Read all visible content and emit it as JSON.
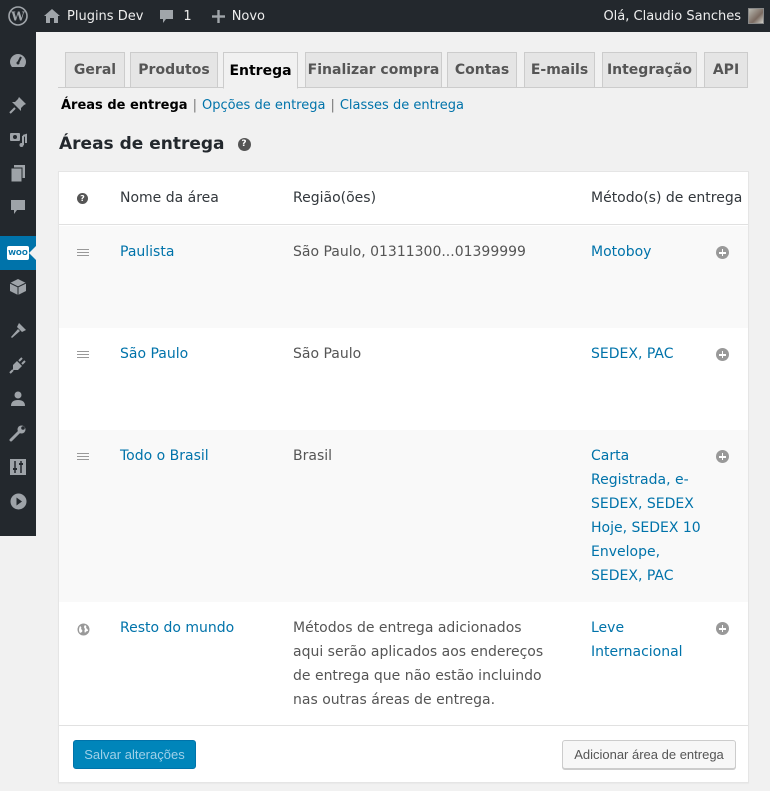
{
  "adminbar": {
    "site_name": "Plugins Dev",
    "comments_count": "1",
    "new_label": "Novo",
    "greeting": "Olá, Claudio Sanches"
  },
  "sidebar": {
    "items": [
      {
        "icon": "dashboard-icon"
      },
      {
        "icon": "pin-icon"
      },
      {
        "icon": "media-icon"
      },
      {
        "icon": "pages-icon"
      },
      {
        "icon": "comments-icon"
      },
      {
        "icon": "woocommerce-icon",
        "label": "WOO",
        "active": true
      },
      {
        "icon": "products-box-icon"
      },
      {
        "icon": "appearance-brush-icon"
      },
      {
        "icon": "plugins-icon"
      },
      {
        "icon": "users-icon"
      },
      {
        "icon": "tools-icon"
      },
      {
        "icon": "settings-icon"
      },
      {
        "icon": "play-icon"
      }
    ],
    "active_color": "#0073aa"
  },
  "tabs": [
    {
      "label": "Geral"
    },
    {
      "label": "Produtos"
    },
    {
      "label": "Entrega",
      "active": true
    },
    {
      "label": "Finalizar compra"
    },
    {
      "label": "Contas"
    },
    {
      "label": "E-mails"
    },
    {
      "label": "Integração"
    },
    {
      "label": "API"
    }
  ],
  "subnav": {
    "current": "Áreas de entrega",
    "links": [
      "Opções de entrega",
      "Classes de entrega"
    ],
    "separator": "|"
  },
  "page_title": "Áreas de entrega",
  "help_glyph": "?",
  "table": {
    "headers": {
      "name": "Nome da área",
      "regions": "Região(ões)",
      "methods": "Método(s) de entrega"
    },
    "rows": [
      {
        "name": "Paulista",
        "region": "São Paulo, 01311300...01399999",
        "methods_text": "Motoboy",
        "methods": [
          "Motoboy"
        ]
      },
      {
        "name": "São Paulo",
        "region": "São Paulo",
        "methods_text": "SEDEX, PAC",
        "methods": [
          "SEDEX",
          "PAC"
        ]
      },
      {
        "name": "Todo o Brasil",
        "region": "Brasil",
        "methods_text": "Carta Registrada, e-SEDEX, SEDEX Hoje, SEDEX 10 Envelope, SEDEX, PAC",
        "methods": [
          "Carta Registrada",
          "e-SEDEX",
          "SEDEX Hoje",
          "SEDEX 10 Envelope",
          "SEDEX",
          "PAC"
        ]
      },
      {
        "name": "Resto do mundo",
        "region": "Métodos de entrega adicionados aqui serão aplicados aos endereços de entrega que não estão incluindo nas outras áreas de entrega.",
        "methods_text": "Leve Internacional",
        "methods": [
          "Leve Internacional"
        ]
      }
    ]
  },
  "footer": {
    "save_label": "Salvar alterações",
    "add_zone_label": "Adicionar área de entrega"
  },
  "colors": {
    "link": "#0073aa",
    "primary_button": "#0085ba",
    "adminbar": "#23282d"
  }
}
